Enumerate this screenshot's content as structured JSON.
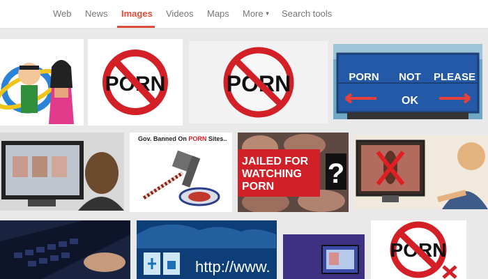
{
  "tabs": [
    {
      "label": "Web",
      "active": false
    },
    {
      "label": "News",
      "active": false
    },
    {
      "label": "Images",
      "active": true
    },
    {
      "label": "Videos",
      "active": false
    },
    {
      "label": "Maps",
      "active": false
    },
    {
      "label": "More",
      "active": false
    },
    {
      "label": "Search tools",
      "active": false
    }
  ],
  "colors": {
    "active_tab": "#dd4b39",
    "tab_text": "#777777",
    "ban_red": "#d32027",
    "page_bg": "#e9e9e9"
  },
  "results": {
    "r1c2_text": "PORN",
    "r1c3_text": "PORN",
    "r1c4_left": "PORN",
    "r1c4_middle": "NOT",
    "r1c4_right": "PLEASE",
    "r1c4_bottom": "OK",
    "r2c2_caption_a": "Gov. Banned On ",
    "r2c2_caption_b": "PORN",
    "r2c2_caption_c": " Sites..",
    "r2c3_line1": "JAILED FOR",
    "r2c3_line2": "WATCHING",
    "r2c3_line3": "PORN",
    "r2c3_mark": "?",
    "r3c2_url": "http://www.",
    "r3c4_text": "PORN"
  }
}
